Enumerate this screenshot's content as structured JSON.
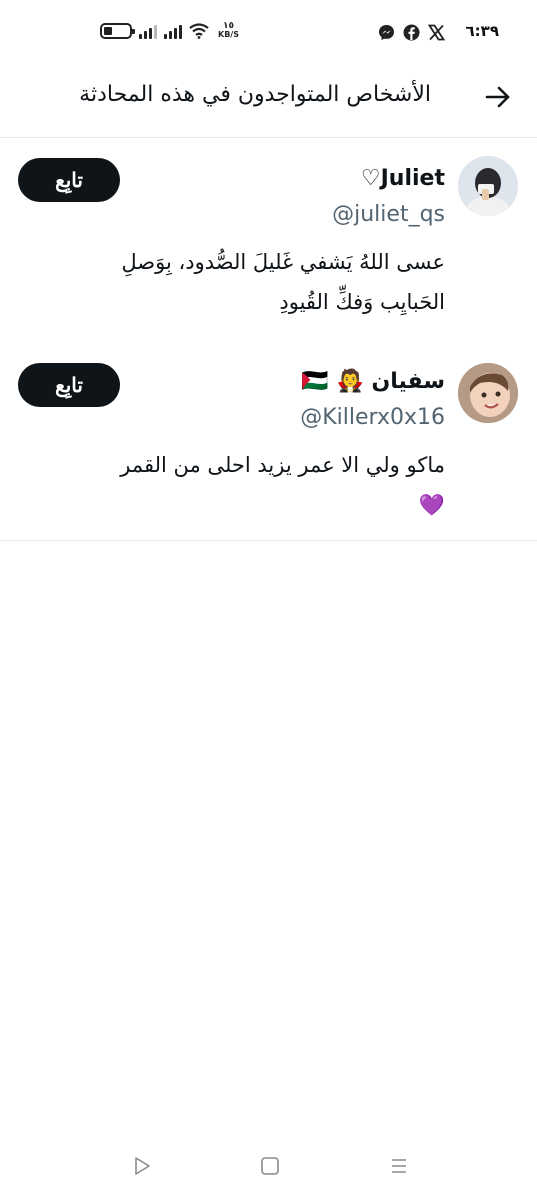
{
  "status_bar": {
    "time": "٦:٣٩",
    "net_speed_value": "١٥",
    "net_speed_unit": "KB/S",
    "battery_level": 0.2,
    "app_icons": [
      "x-icon",
      "facebook-icon",
      "messenger-icon"
    ]
  },
  "header": {
    "title": "الأشخاص المتواجدون في هذه المحادثة",
    "back_icon": "arrow-right-icon"
  },
  "users": [
    {
      "display_name": "Juliet♡",
      "handle": "@juliet_qs",
      "bio_lines": [
        "عسى اللهُ يَشفي غَليلَ الصُّدود، بِوَصلِ",
        "الحَبايِب وَفكِّ القُيودِ"
      ],
      "follow_label": "تابِع"
    },
    {
      "display_name": "سفيان 🧛 🇵🇸",
      "handle": "@Killerx0x16",
      "bio_lines": [
        "ماكو ولي الا عمر يزيد احلى من القمر",
        "💜"
      ],
      "follow_label": "تابِع"
    }
  ],
  "nav_bar": {
    "items": [
      "back-triangle-icon",
      "home-square-icon",
      "menu-lines-icon"
    ]
  },
  "colors": {
    "text_primary": "#0f1419",
    "text_secondary": "#536471",
    "button_bg": "#0f1419",
    "divider": "#e6e8ea"
  }
}
